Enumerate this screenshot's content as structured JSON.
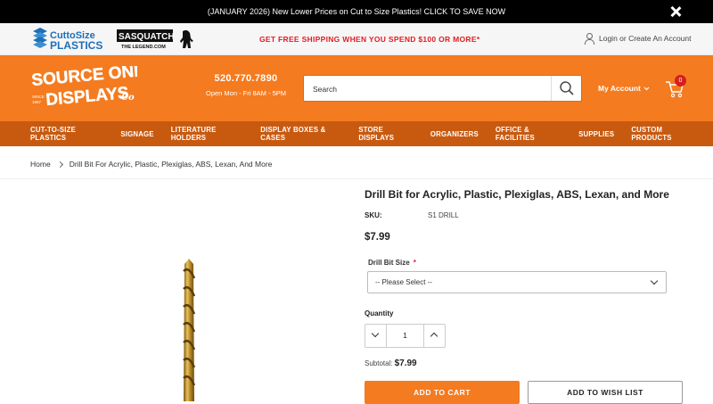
{
  "announcement": "(JANUARY 2026) New Lower Prices on Cut to Size Plastics! CLICK TO SAVE NOW",
  "subheader": {
    "logo_cut": {
      "line1": "CuttoSize",
      "line2": "PLASTICS"
    },
    "logo_sas": {
      "line1": "SASQUATCH",
      "line2": "THE LEGEND.COM"
    },
    "shipping": "GET FREE SHIPPING WHEN YOU SPEND $100 OR MORE*",
    "login": "Login or Create An Account"
  },
  "header": {
    "brand": {
      "line1": "SOURCE ONE",
      "line2": "DISPLAYS",
      "co": "Co",
      "since": "SINCE",
      "year": "1997"
    },
    "phone": "520.770.7890",
    "hours": "Open Mon - Fri 8AM - 5PM",
    "search_placeholder": "Search",
    "account": "My Account",
    "cart_count": "0"
  },
  "nav": [
    "CUT-TO-SIZE PLASTICS",
    "SIGNAGE",
    "LITERATURE HOLDERS",
    "DISPLAY BOXES & CASES",
    "STORE DISPLAYS",
    "ORGANIZERS",
    "OFFICE & FACILITIES",
    "SUPPLIES",
    "CUSTOM PRODUCTS"
  ],
  "breadcrumb": {
    "home": "Home",
    "current": "Drill Bit For Acrylic, Plastic, Plexiglas, ABS, Lexan, And More"
  },
  "product": {
    "title": "Drill Bit for Acrylic, Plastic, Plexiglas, ABS, Lexan, and More",
    "sku_label": "SKU:",
    "sku": "S1 DRILL",
    "price": "$7.99",
    "option_label": "Drill Bit Size",
    "required_mark": "*",
    "option_selected": "-- Please Select --",
    "qty_label": "Quantity",
    "qty": "1",
    "subtotal_label": "Subtotal:",
    "subtotal": "$7.99",
    "add_to_cart": "ADD TO CART",
    "wishlist": "ADD TO WISH LIST"
  },
  "colors": {
    "orange": "#f47b20",
    "nav": "#c85a10",
    "red": "#e31b23",
    "blue": "#1d6fb8"
  }
}
